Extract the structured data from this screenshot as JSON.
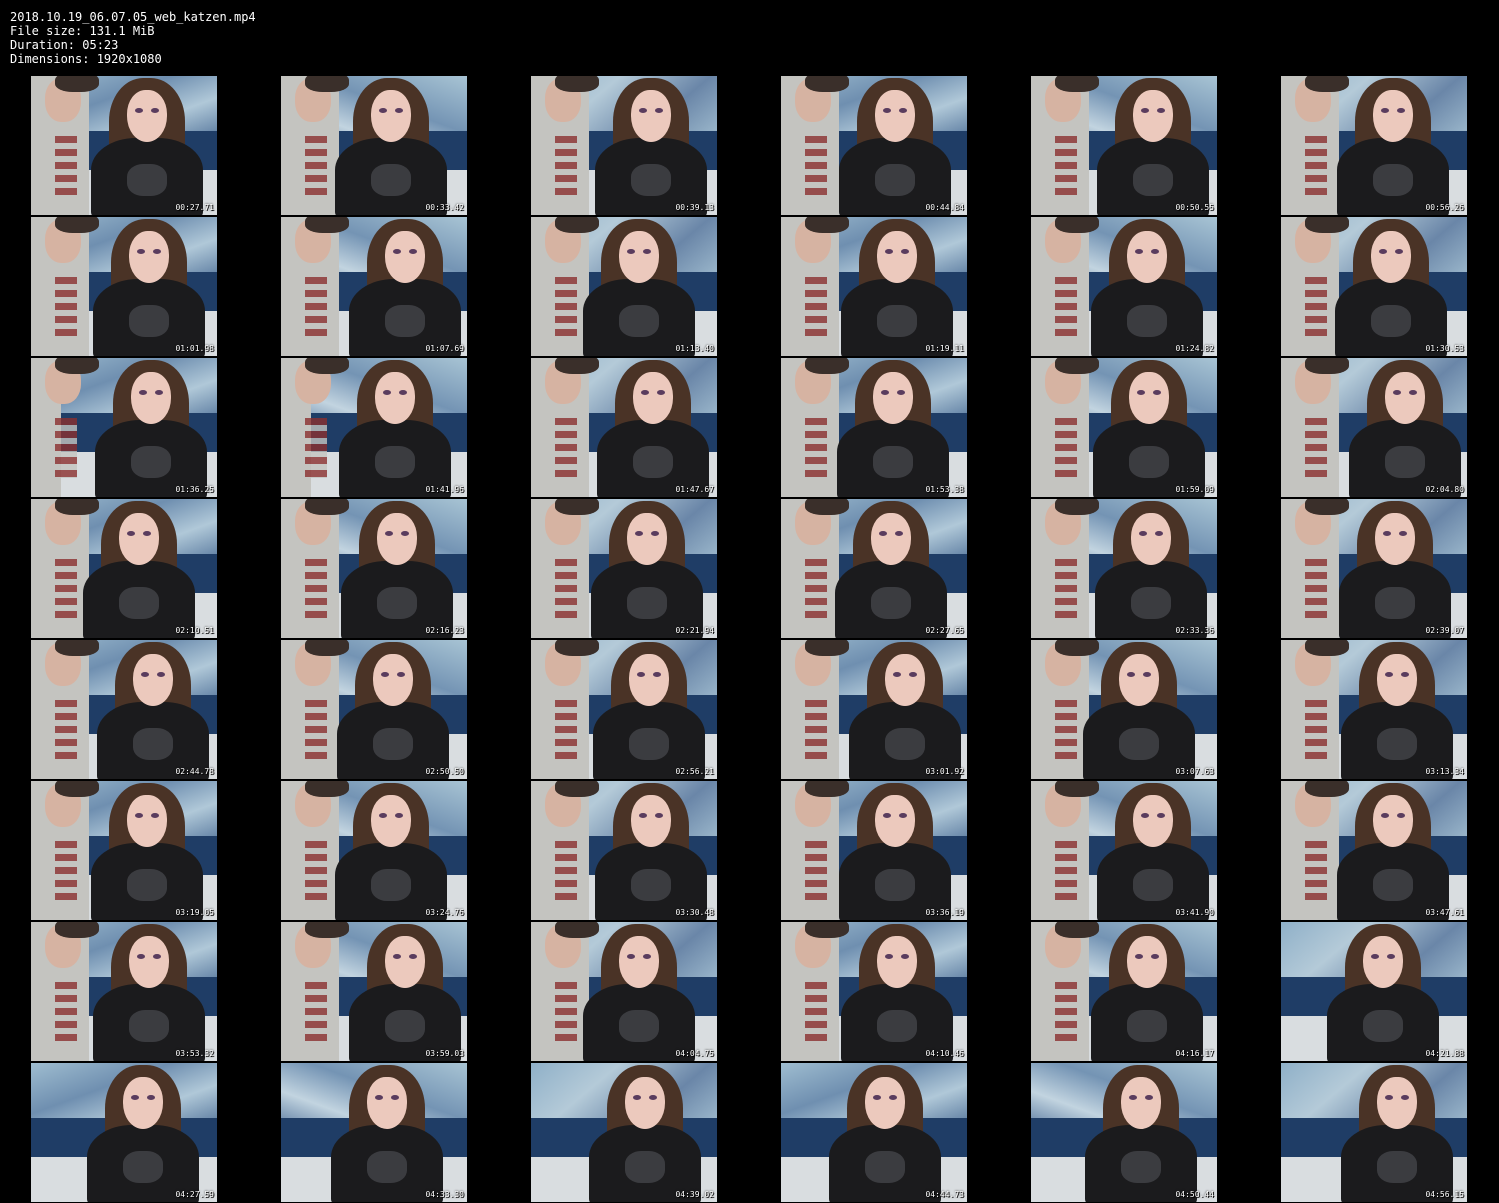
{
  "file_info": {
    "filename": "2018.10.19_06.07.05_web_katzen.mp4",
    "file_size": "File size: 131.1 MiB",
    "duration": "Duration: 05:23",
    "dimensions": "Dimensions: 1920x1080"
  },
  "thumbnails": [
    {
      "timestamp": "00:27.71"
    },
    {
      "timestamp": "00:33.42"
    },
    {
      "timestamp": "00:39.13"
    },
    {
      "timestamp": "00:44.84"
    },
    {
      "timestamp": "00:50.55"
    },
    {
      "timestamp": "00:56.26"
    },
    {
      "timestamp": "01:01.98"
    },
    {
      "timestamp": "01:07.69"
    },
    {
      "timestamp": "01:13.40"
    },
    {
      "timestamp": "01:19.11"
    },
    {
      "timestamp": "01:24.82"
    },
    {
      "timestamp": "01:30.53"
    },
    {
      "timestamp": "01:36.25"
    },
    {
      "timestamp": "01:41.96"
    },
    {
      "timestamp": "01:47.67"
    },
    {
      "timestamp": "01:53.38"
    },
    {
      "timestamp": "01:59.09"
    },
    {
      "timestamp": "02:04.80"
    },
    {
      "timestamp": "02:10.51"
    },
    {
      "timestamp": "02:16.23"
    },
    {
      "timestamp": "02:21.94"
    },
    {
      "timestamp": "02:27.65"
    },
    {
      "timestamp": "02:33.36"
    },
    {
      "timestamp": "02:39.07"
    },
    {
      "timestamp": "02:44.78"
    },
    {
      "timestamp": "02:50.50"
    },
    {
      "timestamp": "02:56.21"
    },
    {
      "timestamp": "03:01.92"
    },
    {
      "timestamp": "03:07.63"
    },
    {
      "timestamp": "03:13.34"
    },
    {
      "timestamp": "03:19.05"
    },
    {
      "timestamp": "03:24.76"
    },
    {
      "timestamp": "03:30.48"
    },
    {
      "timestamp": "03:36.19"
    },
    {
      "timestamp": "03:41.90"
    },
    {
      "timestamp": "03:47.61"
    },
    {
      "timestamp": "03:53.32"
    },
    {
      "timestamp": "03:59.03"
    },
    {
      "timestamp": "04:04.75"
    },
    {
      "timestamp": "04:10.46"
    },
    {
      "timestamp": "04:16.17"
    },
    {
      "timestamp": "04:21.88"
    },
    {
      "timestamp": "04:27.59"
    },
    {
      "timestamp": "04:33.30"
    },
    {
      "timestamp": "04:39.02"
    },
    {
      "timestamp": "04:44.73"
    },
    {
      "timestamp": "04:50.44"
    },
    {
      "timestamp": "04:56.15"
    }
  ],
  "colors": {
    "background": "#000000",
    "text": "#ffffff",
    "sky": "#7f9bb0",
    "sofa": "#1f3d66",
    "shirt": "#1b1b1d",
    "hair": "#4a3326",
    "skin": "#ecc9bd"
  }
}
